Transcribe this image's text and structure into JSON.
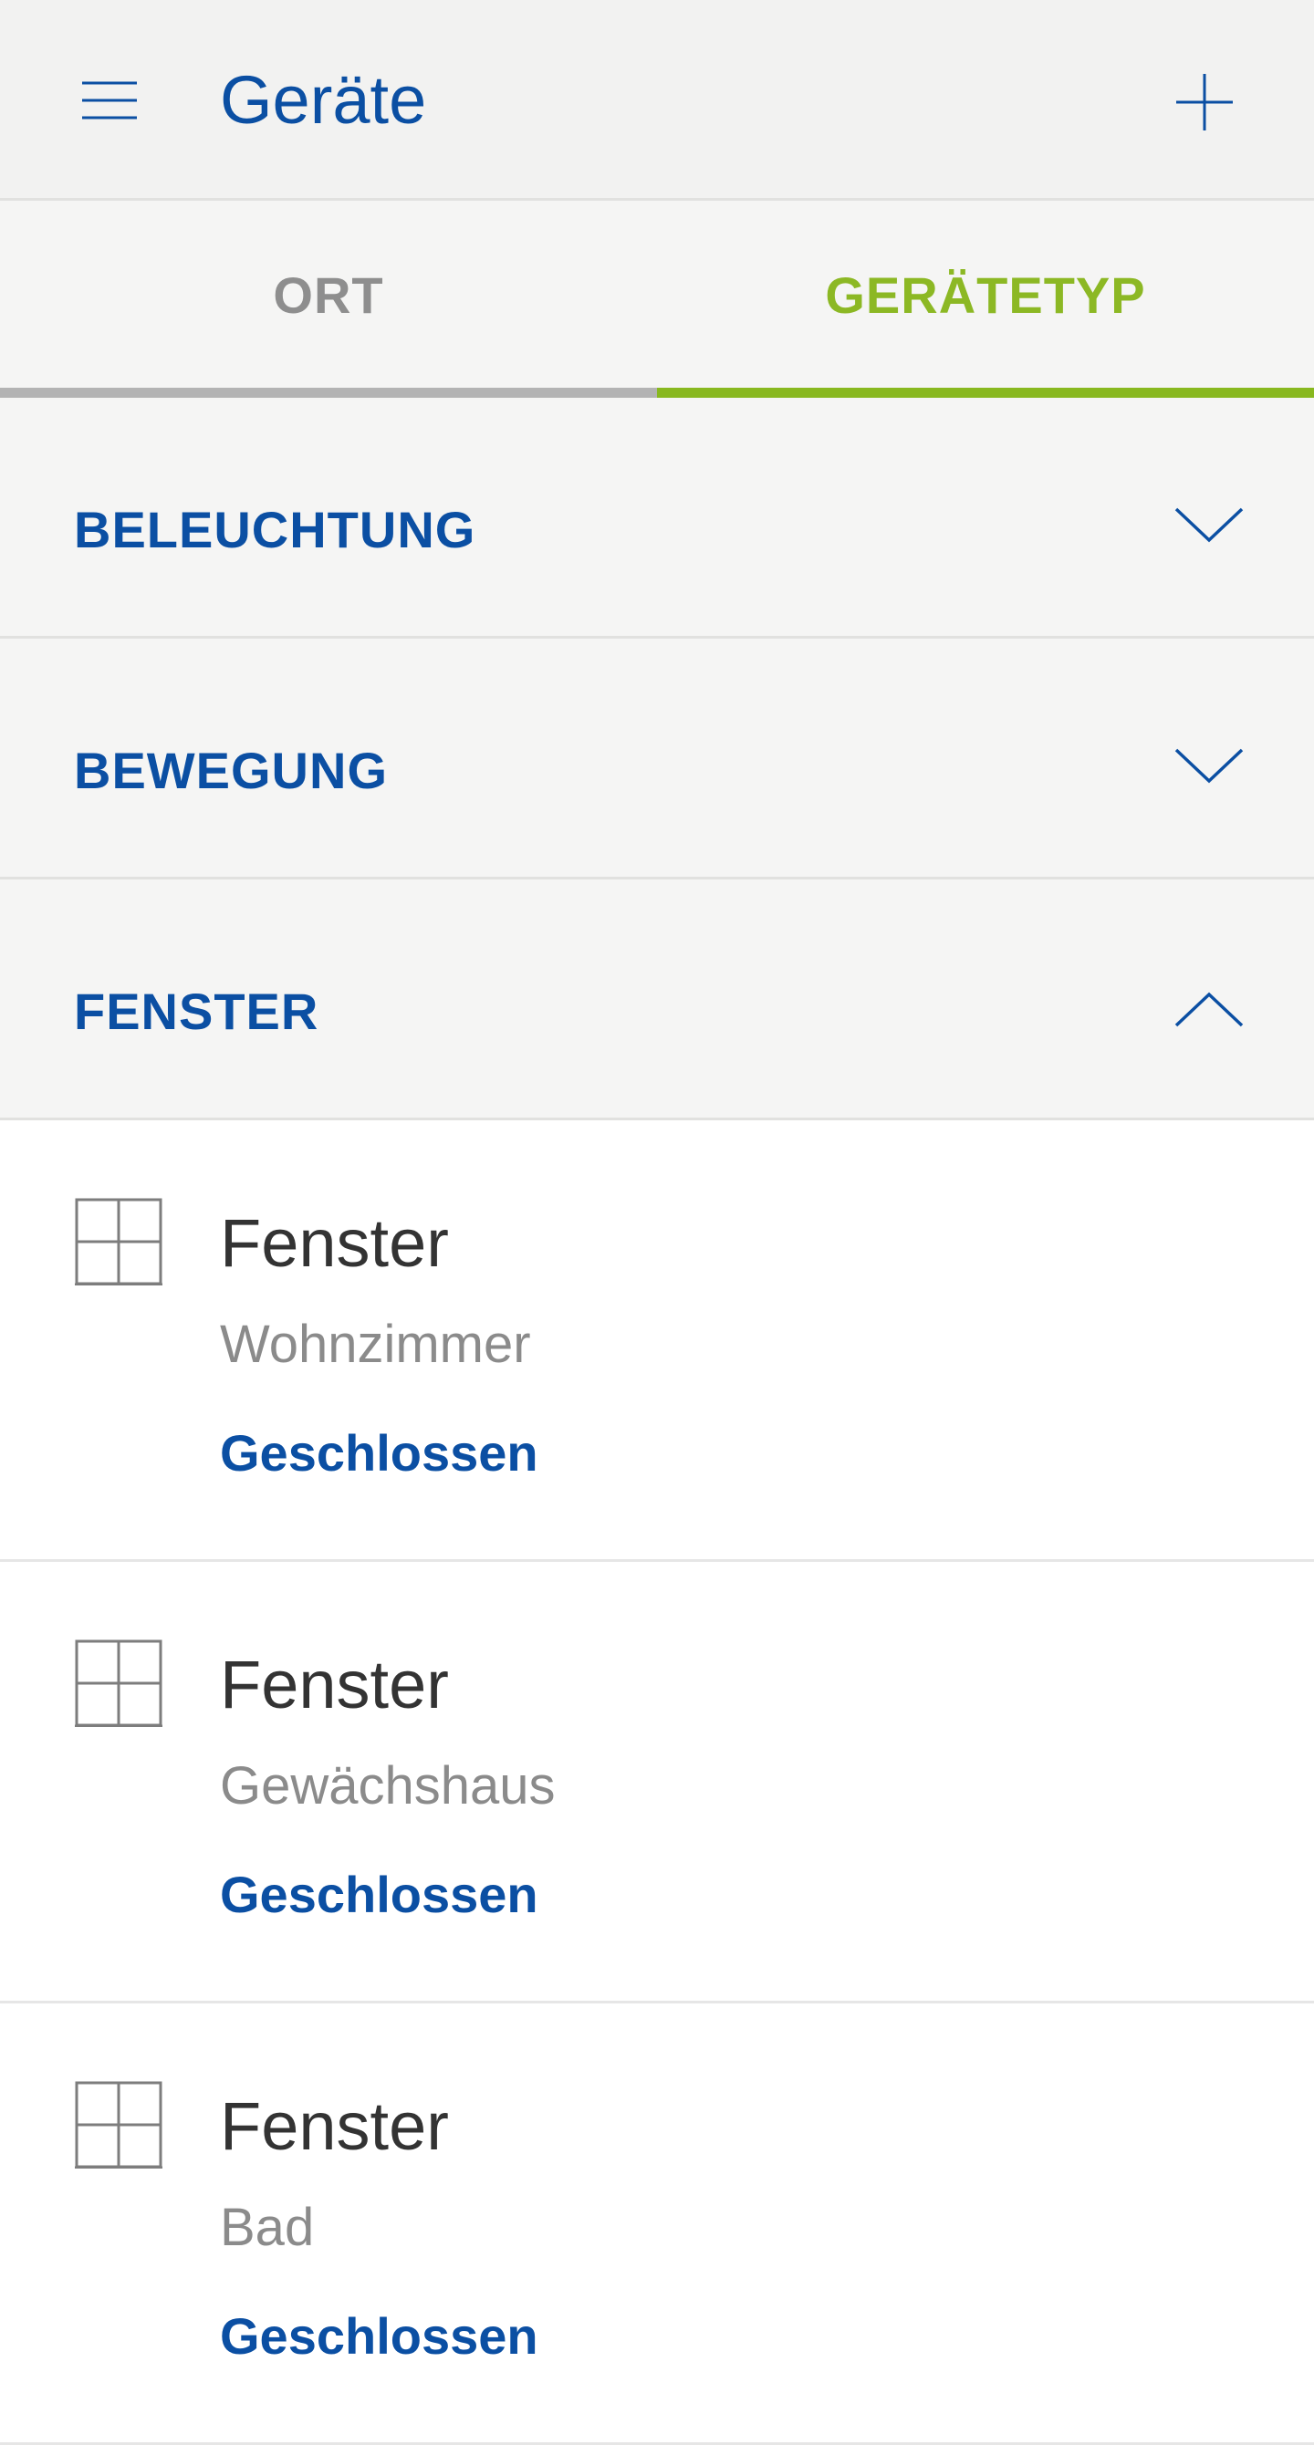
{
  "header": {
    "title": "Geräte",
    "menu_icon": "menu-icon",
    "add_icon": "plus-icon"
  },
  "tabs": [
    {
      "label": "ORT",
      "selected": false
    },
    {
      "label": "GERÄTETYP",
      "selected": true
    }
  ],
  "categories": [
    {
      "label": "BELEUCHTUNG",
      "expanded": false,
      "icon": "chevron-down-icon"
    },
    {
      "label": "BEWEGUNG",
      "expanded": false,
      "icon": "chevron-down-icon"
    },
    {
      "label": "FENSTER",
      "expanded": true,
      "icon": "chevron-up-icon"
    }
  ],
  "devices": [
    {
      "name": "Fenster",
      "room": "Wohnzimmer",
      "status": "Geschlossen",
      "icon": "window-icon"
    },
    {
      "name": "Fenster",
      "room": "Gewächshaus",
      "status": "Geschlossen",
      "icon": "window-icon"
    },
    {
      "name": "Fenster",
      "room": "Bad",
      "status": "Geschlossen",
      "icon": "window-icon"
    }
  ],
  "colors": {
    "brand_blue": "#0b4fa3",
    "accent_green": "#88b81f",
    "inactive_gray": "#8e8e8e",
    "header_bg": "#f2f2f1"
  }
}
